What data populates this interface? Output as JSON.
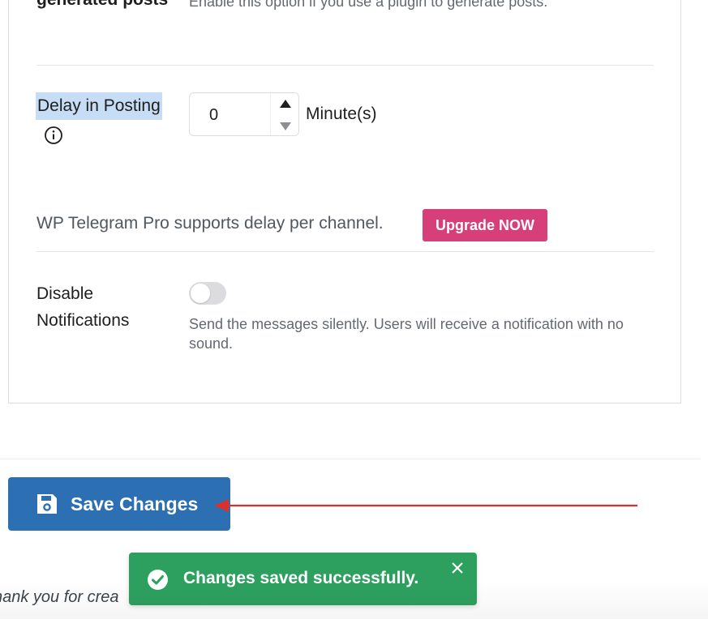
{
  "previous_setting": {
    "label": "generated posts",
    "description": "Enable this option if you use a plugin to generate posts."
  },
  "delay": {
    "label": "Delay in Posting",
    "value": "0",
    "unit": "Minute(s)",
    "info_icon": "info-circle-icon"
  },
  "pro_notice": {
    "text": "WP Telegram Pro supports delay per channel.",
    "button_label": "Upgrade NOW",
    "button_color": "#d63f7a"
  },
  "disable_notifications": {
    "label_line1": "Disable",
    "label_line2": "Notifications",
    "enabled": false,
    "description": "Send the messages silently. Users will receive a notification with no sound."
  },
  "actions": {
    "save_label": "Save Changes",
    "save_icon": "floppy-disk-icon",
    "save_color": "#2c6fb2",
    "annotation_arrow_color": "#d9322e"
  },
  "toast": {
    "message": "Changes saved successfully.",
    "icon": "check-circle-icon",
    "close_icon": "close-icon",
    "color": "#2da05f"
  },
  "footer": {
    "text": "hank you for crea"
  }
}
